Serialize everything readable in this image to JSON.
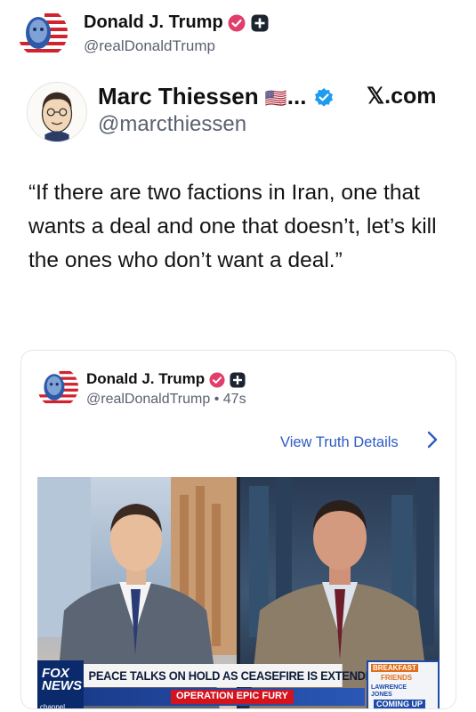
{
  "post": {
    "author_name": "Donald J. Trump",
    "author_handle": "@realDonaldTrump"
  },
  "quoted": {
    "author_name": "Marc Thiessen",
    "flag_emoji": "🇺🇸",
    "ellipsis": "...",
    "author_handle": "@marcthiessen",
    "platform": "𝕏.com",
    "text": "“If there are two factions in Iran, one that wants a deal and one that doesn’t, let’s kill the ones who don’t want a deal.”"
  },
  "card": {
    "author_name": "Donald J. Trump",
    "author_handle": "@realDonaldTrump",
    "separator": "•",
    "age": "47s",
    "view_details": "View Truth Details",
    "video": {
      "headline": "PEACE TALKS ON HOLD AS CEASEFIRE IS EXTENDED",
      "sub_label": "OPERATION EPIC FURY",
      "network_line1": "FOX",
      "network_line2": "NEWS",
      "network_line3": "channel",
      "promo_line1": "BREAKFAST",
      "promo_line2": "FRIENDS",
      "promo_line3": "LAWRENCE JONES",
      "promo_line4": "COMING UP"
    }
  },
  "colors": {
    "link": "#2d5bc4",
    "verified_pink": "#e23e6b",
    "verified_blue": "#1d9bf0"
  },
  "icons": [
    "verified-badge-icon",
    "plus-badge-icon",
    "chevron-right-icon",
    "flag-icon"
  ]
}
